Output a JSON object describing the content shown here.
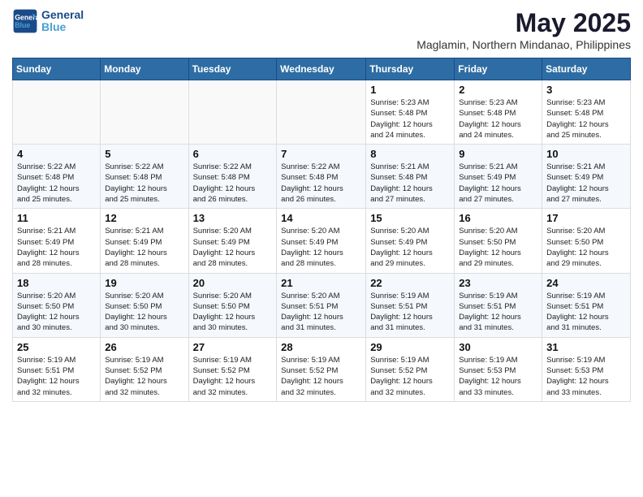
{
  "header": {
    "logo_line1": "General",
    "logo_line2": "Blue",
    "main_title": "May 2025",
    "subtitle": "Maglamin, Northern Mindanao, Philippines"
  },
  "weekdays": [
    "Sunday",
    "Monday",
    "Tuesday",
    "Wednesday",
    "Thursday",
    "Friday",
    "Saturday"
  ],
  "weeks": [
    [
      {
        "day": "",
        "info": ""
      },
      {
        "day": "",
        "info": ""
      },
      {
        "day": "",
        "info": ""
      },
      {
        "day": "",
        "info": ""
      },
      {
        "day": "1",
        "info": "Sunrise: 5:23 AM\nSunset: 5:48 PM\nDaylight: 12 hours\nand 24 minutes."
      },
      {
        "day": "2",
        "info": "Sunrise: 5:23 AM\nSunset: 5:48 PM\nDaylight: 12 hours\nand 24 minutes."
      },
      {
        "day": "3",
        "info": "Sunrise: 5:23 AM\nSunset: 5:48 PM\nDaylight: 12 hours\nand 25 minutes."
      }
    ],
    [
      {
        "day": "4",
        "info": "Sunrise: 5:22 AM\nSunset: 5:48 PM\nDaylight: 12 hours\nand 25 minutes."
      },
      {
        "day": "5",
        "info": "Sunrise: 5:22 AM\nSunset: 5:48 PM\nDaylight: 12 hours\nand 25 minutes."
      },
      {
        "day": "6",
        "info": "Sunrise: 5:22 AM\nSunset: 5:48 PM\nDaylight: 12 hours\nand 26 minutes."
      },
      {
        "day": "7",
        "info": "Sunrise: 5:22 AM\nSunset: 5:48 PM\nDaylight: 12 hours\nand 26 minutes."
      },
      {
        "day": "8",
        "info": "Sunrise: 5:21 AM\nSunset: 5:48 PM\nDaylight: 12 hours\nand 27 minutes."
      },
      {
        "day": "9",
        "info": "Sunrise: 5:21 AM\nSunset: 5:49 PM\nDaylight: 12 hours\nand 27 minutes."
      },
      {
        "day": "10",
        "info": "Sunrise: 5:21 AM\nSunset: 5:49 PM\nDaylight: 12 hours\nand 27 minutes."
      }
    ],
    [
      {
        "day": "11",
        "info": "Sunrise: 5:21 AM\nSunset: 5:49 PM\nDaylight: 12 hours\nand 28 minutes."
      },
      {
        "day": "12",
        "info": "Sunrise: 5:21 AM\nSunset: 5:49 PM\nDaylight: 12 hours\nand 28 minutes."
      },
      {
        "day": "13",
        "info": "Sunrise: 5:20 AM\nSunset: 5:49 PM\nDaylight: 12 hours\nand 28 minutes."
      },
      {
        "day": "14",
        "info": "Sunrise: 5:20 AM\nSunset: 5:49 PM\nDaylight: 12 hours\nand 28 minutes."
      },
      {
        "day": "15",
        "info": "Sunrise: 5:20 AM\nSunset: 5:49 PM\nDaylight: 12 hours\nand 29 minutes."
      },
      {
        "day": "16",
        "info": "Sunrise: 5:20 AM\nSunset: 5:50 PM\nDaylight: 12 hours\nand 29 minutes."
      },
      {
        "day": "17",
        "info": "Sunrise: 5:20 AM\nSunset: 5:50 PM\nDaylight: 12 hours\nand 29 minutes."
      }
    ],
    [
      {
        "day": "18",
        "info": "Sunrise: 5:20 AM\nSunset: 5:50 PM\nDaylight: 12 hours\nand 30 minutes."
      },
      {
        "day": "19",
        "info": "Sunrise: 5:20 AM\nSunset: 5:50 PM\nDaylight: 12 hours\nand 30 minutes."
      },
      {
        "day": "20",
        "info": "Sunrise: 5:20 AM\nSunset: 5:50 PM\nDaylight: 12 hours\nand 30 minutes."
      },
      {
        "day": "21",
        "info": "Sunrise: 5:20 AM\nSunset: 5:51 PM\nDaylight: 12 hours\nand 31 minutes."
      },
      {
        "day": "22",
        "info": "Sunrise: 5:19 AM\nSunset: 5:51 PM\nDaylight: 12 hours\nand 31 minutes."
      },
      {
        "day": "23",
        "info": "Sunrise: 5:19 AM\nSunset: 5:51 PM\nDaylight: 12 hours\nand 31 minutes."
      },
      {
        "day": "24",
        "info": "Sunrise: 5:19 AM\nSunset: 5:51 PM\nDaylight: 12 hours\nand 31 minutes."
      }
    ],
    [
      {
        "day": "25",
        "info": "Sunrise: 5:19 AM\nSunset: 5:51 PM\nDaylight: 12 hours\nand 32 minutes."
      },
      {
        "day": "26",
        "info": "Sunrise: 5:19 AM\nSunset: 5:52 PM\nDaylight: 12 hours\nand 32 minutes."
      },
      {
        "day": "27",
        "info": "Sunrise: 5:19 AM\nSunset: 5:52 PM\nDaylight: 12 hours\nand 32 minutes."
      },
      {
        "day": "28",
        "info": "Sunrise: 5:19 AM\nSunset: 5:52 PM\nDaylight: 12 hours\nand 32 minutes."
      },
      {
        "day": "29",
        "info": "Sunrise: 5:19 AM\nSunset: 5:52 PM\nDaylight: 12 hours\nand 32 minutes."
      },
      {
        "day": "30",
        "info": "Sunrise: 5:19 AM\nSunset: 5:53 PM\nDaylight: 12 hours\nand 33 minutes."
      },
      {
        "day": "31",
        "info": "Sunrise: 5:19 AM\nSunset: 5:53 PM\nDaylight: 12 hours\nand 33 minutes."
      }
    ]
  ]
}
